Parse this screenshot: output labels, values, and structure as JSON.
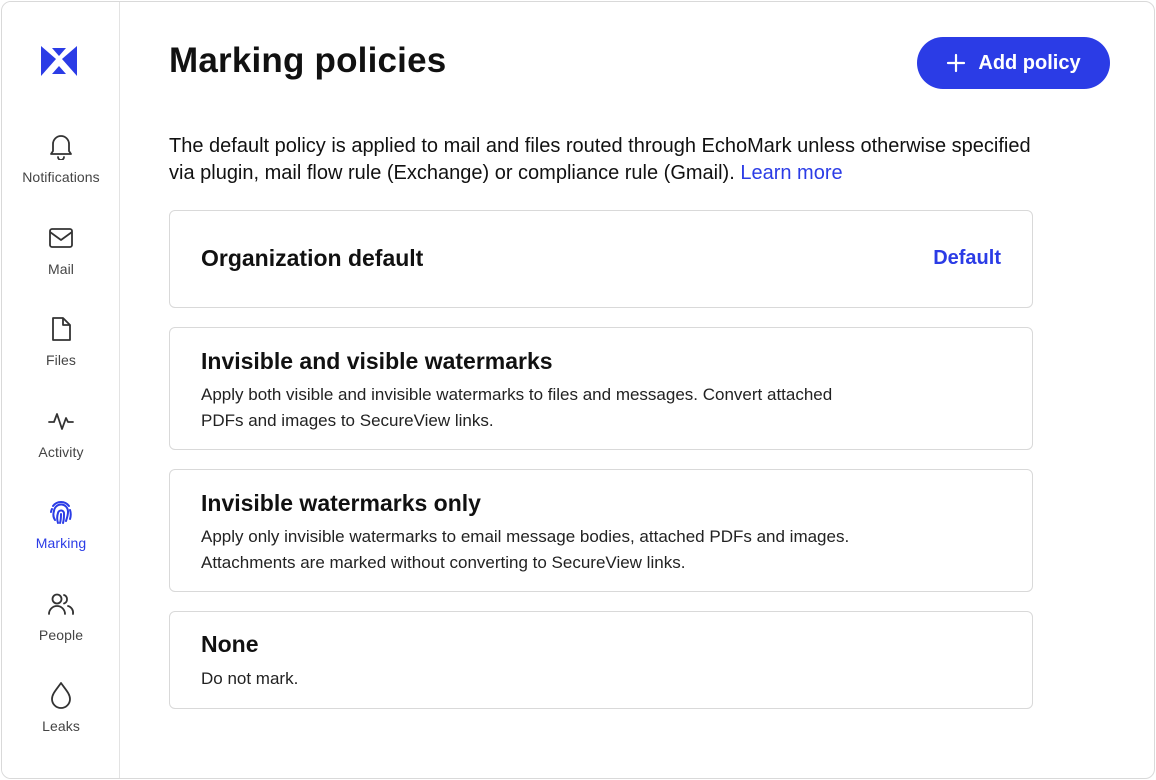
{
  "sidebar": {
    "items": [
      {
        "label": "Notifications",
        "icon": "bell-icon"
      },
      {
        "label": "Mail",
        "icon": "mail-icon"
      },
      {
        "label": "Files",
        "icon": "file-icon"
      },
      {
        "label": "Activity",
        "icon": "activity-icon"
      },
      {
        "label": "Marking",
        "icon": "fingerprint-icon",
        "active": true
      },
      {
        "label": "People",
        "icon": "people-icon"
      },
      {
        "label": "Leaks",
        "icon": "drop-icon"
      }
    ]
  },
  "header": {
    "title": "Marking policies",
    "add_label": "Add policy"
  },
  "intro": {
    "text": "The default policy is applied to mail and files routed through EchoMark unless otherwise specified via plugin, mail flow rule (Exchange) or compliance rule (Gmail).",
    "link": "Learn more"
  },
  "policies": [
    {
      "title": "Organization default",
      "badge": "Default"
    },
    {
      "title": "Invisible and visible watermarks",
      "description": "Apply both visible and invisible watermarks to files and messages. Convert attached PDFs and images to SecureView links."
    },
    {
      "title": "Invisible watermarks only",
      "description": "Apply only invisible watermarks to email message bodies, attached PDFs and images. Attachments are marked without converting to SecureView links."
    },
    {
      "title": "None",
      "description": "Do not mark."
    }
  ],
  "colors": {
    "accent": "#2b3ce6",
    "border": "#d9d9d9"
  }
}
